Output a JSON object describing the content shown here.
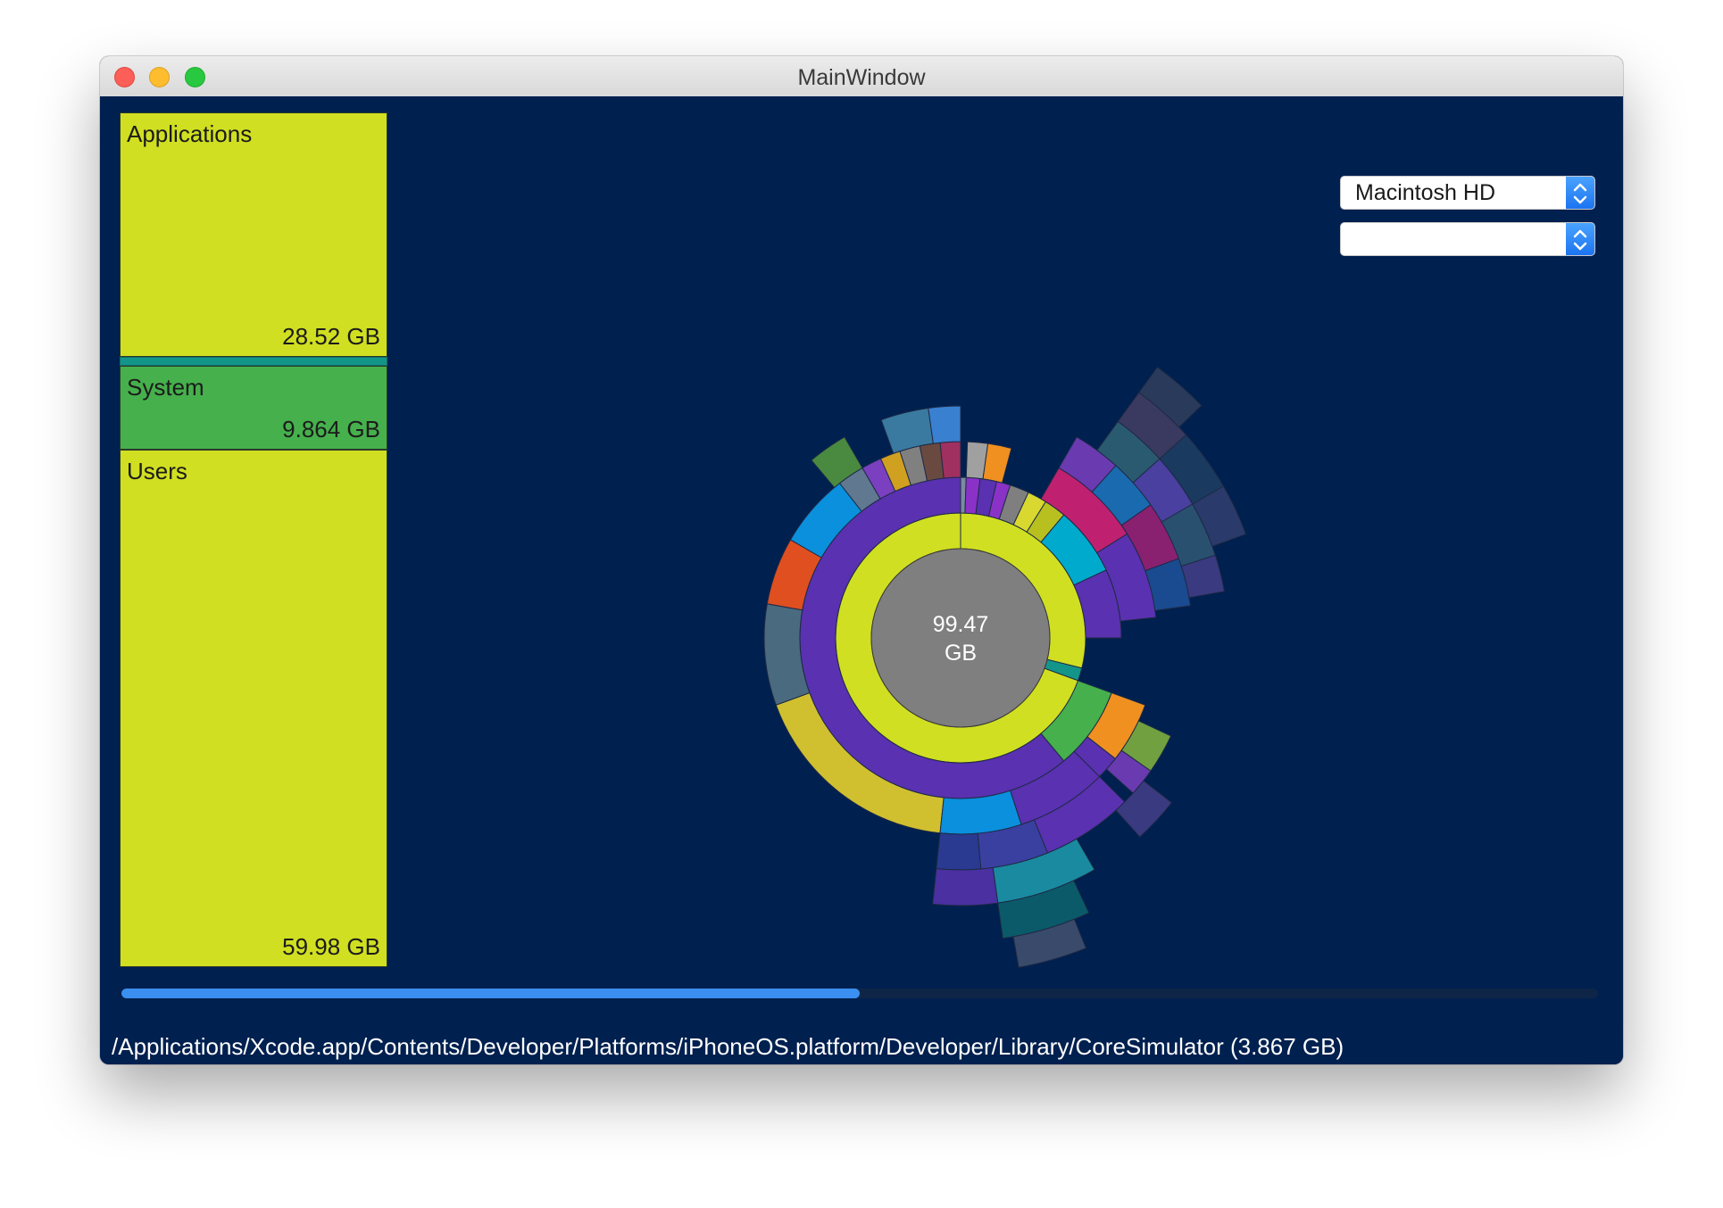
{
  "window": {
    "title": "MainWindow"
  },
  "sidebar": {
    "blocks": [
      {
        "name": "Applications",
        "size": "28.52 GB"
      },
      {
        "name": "System",
        "size": "9.864 GB"
      },
      {
        "name": "Users",
        "size": "59.98 GB"
      }
    ]
  },
  "sunburst": {
    "center_value": "99.47",
    "center_unit": "GB"
  },
  "controls": {
    "volume_select": {
      "value": "Macintosh HD"
    },
    "secondary_select": {
      "value": ""
    }
  },
  "progress": {
    "fraction": 0.5
  },
  "status": {
    "path": "/Applications/Xcode.app/Contents/Developer/Platforms/iPhoneOS.platform/Developer/Library/CoreSimulator (3.867 GB)"
  },
  "colors": {
    "background": "#00204f",
    "accent": "#3a8ff0",
    "applications": "#d0df21",
    "system": "#46b04c",
    "users": "#d0df21",
    "center": "#7f7f7f"
  },
  "icons": [
    "close-button",
    "minimize-button",
    "zoom-button",
    "chevron-updown-icon"
  ]
}
